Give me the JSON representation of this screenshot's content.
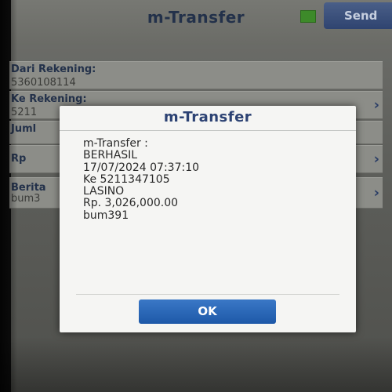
{
  "header": {
    "title": "m-Transfer",
    "send_label": "Send"
  },
  "form": {
    "rows": [
      {
        "label": "Dari Rekening:",
        "value": "5360108114"
      },
      {
        "label": "Ke Rekening:",
        "value": "5211"
      },
      {
        "label": "Juml",
        "value": ""
      },
      {
        "label": "Rp",
        "value": ""
      },
      {
        "label": "Berita",
        "value": "bum3"
      }
    ]
  },
  "dialog": {
    "title": "m-Transfer",
    "lines": [
      "m-Transfer :",
      "BERHASIL",
      "17/07/2024 07:37:10",
      "Ke 5211347105",
      "LASINO",
      "Rp. 3,026,000.00",
      "bum391"
    ],
    "ok_label": "OK"
  },
  "colors": {
    "dialog_title": "#2c4273",
    "ok_button": "#1d58a8",
    "status_indicator": "#3d8a2a"
  }
}
